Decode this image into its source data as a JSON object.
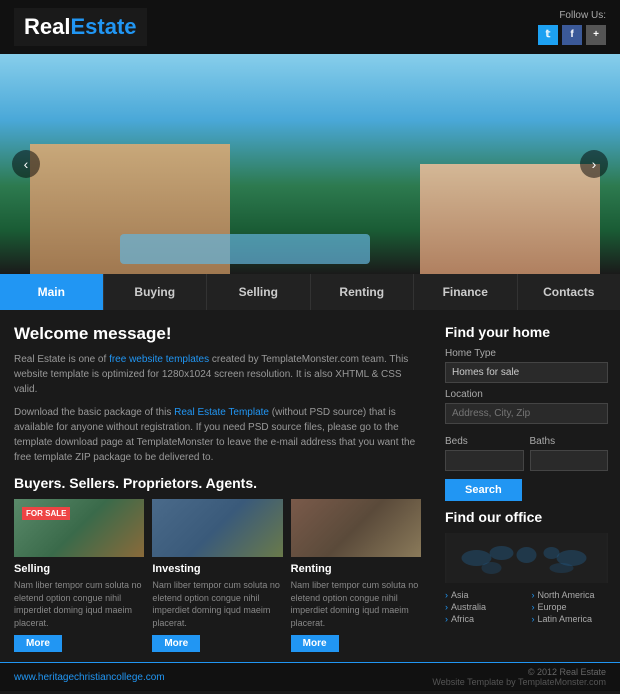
{
  "header": {
    "logo_real": "Real",
    "logo_estate": "Estate",
    "follow_label": "Follow Us:"
  },
  "nav": {
    "items": [
      {
        "label": "Main",
        "active": true
      },
      {
        "label": "Buying",
        "active": false
      },
      {
        "label": "Selling",
        "active": false
      },
      {
        "label": "Renting",
        "active": false
      },
      {
        "label": "Finance",
        "active": false
      },
      {
        "label": "Contacts",
        "active": false
      }
    ]
  },
  "welcome": {
    "title": "Welcome message!",
    "text1": "Real Estate is one of ",
    "link1": "free website templates",
    "text2": " created by TemplateMonster.com team. This website template is optimized for 1280x1024 screen resolution. It is also XHTML & CSS valid.",
    "text3": "Download the basic package of this ",
    "link2": "Real Estate Template",
    "text4": " (without PSD source) that is available for anyone without registration. If you need PSD source files, please go to the template download page at TemplateMonster to leave the e-mail address that you want the free template ZIP package to be delivered to."
  },
  "buyers_section": {
    "title": "Buyers. Sellers. Proprietors. Agents."
  },
  "cards": [
    {
      "title": "Selling",
      "badge": "FOR SALE",
      "text": "Nam liber tempor cum soluta no eletend option congue nihil imperdiet doming iqud maeim placerat."
    },
    {
      "title": "Investing",
      "text": "Nam liber tempor cum soluta no eletend option congue nihil imperdiet doming iqud maeim placerat."
    },
    {
      "title": "Renting",
      "text": "Nam liber tempor cum soluta no eletend option congue nihil imperdiet doming iqud maeim placerat."
    }
  ],
  "more_label": "More",
  "find_home": {
    "title": "Find your home",
    "home_type_label": "Home Type",
    "home_type_value": "Homes for sale",
    "location_label": "Location",
    "location_placeholder": "Address, City, Zip",
    "beds_label": "Beds",
    "baths_label": "Baths",
    "search_label": "Search"
  },
  "find_office": {
    "title": "Find our office",
    "regions": [
      {
        "label": "Asia"
      },
      {
        "label": "Australia"
      },
      {
        "label": "Africa"
      },
      {
        "label": "North America"
      },
      {
        "label": "Europe"
      },
      {
        "label": "Latin America"
      }
    ]
  },
  "footer": {
    "url": "www.heritagechristiancollege.com",
    "copy": "© 2012 Real Estate",
    "by": "Website Template by TemplateMonster.com"
  }
}
